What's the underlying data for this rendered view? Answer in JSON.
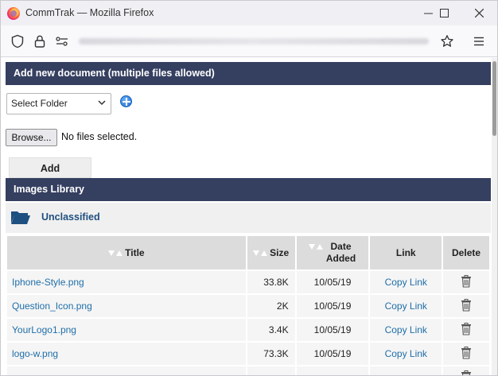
{
  "window": {
    "title": "CommTrak — Mozilla Firefox"
  },
  "upload": {
    "header": "Add new document (multiple files allowed)",
    "folder_select": "Select Folder",
    "browse_label": "Browse...",
    "file_status": "No files selected.",
    "add_label": "Add"
  },
  "library": {
    "header": "Images Library",
    "folder_name": "Unclassified",
    "columns": {
      "title": "Title",
      "size": "Size",
      "date": "Date Added",
      "link": "Link",
      "delete": "Delete"
    },
    "rows": [
      {
        "title": "Iphone-Style.png",
        "size": "33.8K",
        "date": "10/05/19",
        "link": "Copy Link"
      },
      {
        "title": "Question_Icon.png",
        "size": "2K",
        "date": "10/05/19",
        "link": "Copy Link"
      },
      {
        "title": "YourLogo1.png",
        "size": "3.4K",
        "date": "10/05/19",
        "link": "Copy Link"
      },
      {
        "title": "logo-w.png",
        "size": "73.3K",
        "date": "10/05/19",
        "link": "Copy Link"
      },
      {
        "title": "",
        "size": "",
        "date": "",
        "link": ""
      }
    ]
  },
  "colors": {
    "header_bg": "#353f60",
    "link": "#1f6ea8",
    "folder": "#1f4f7f"
  }
}
